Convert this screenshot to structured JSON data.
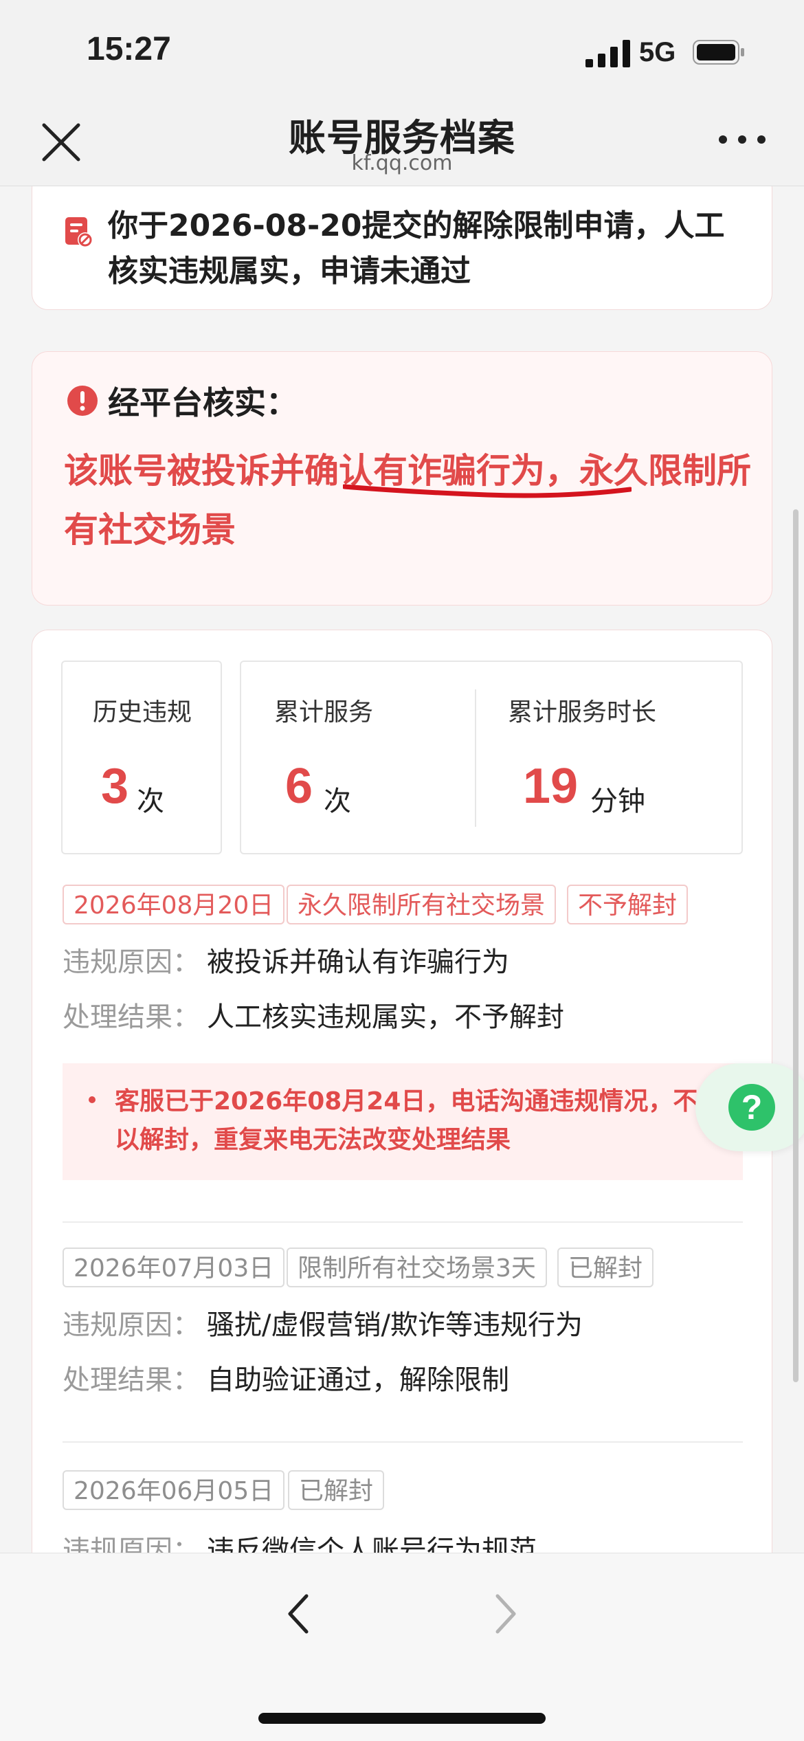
{
  "status_bar": {
    "time": "15:27",
    "network": "5G"
  },
  "nav": {
    "title": "账号服务档案",
    "domain": "kf.qq.com"
  },
  "notice": {
    "text": "你于2026-08-20提交的解除限制申请，人工核实违规属实，申请未通过"
  },
  "verification": {
    "title": "经平台核实：",
    "message": "该账号被投诉并确认有诈骗行为，永久限制所有社交场景"
  },
  "stats": [
    {
      "label": "历史违规",
      "value": "3",
      "unit": "次"
    },
    {
      "label": "累计服务",
      "value": "6",
      "unit": "次"
    },
    {
      "label": "累计服务时长",
      "value": "19",
      "unit": "分钟"
    }
  ],
  "labels": {
    "reason": "违规原因：",
    "result": "处理结果："
  },
  "records": [
    {
      "tags": [
        "2026年08月20日",
        "永久限制所有社交场景",
        "不予解封"
      ],
      "reason": "被投诉并确认有诈骗行为",
      "result": "人工核实违规属实，不予解封",
      "remark": "客服已于2026年08月24日，电话沟通违规情况，不予以解封，重复来电无法改变处理结果"
    },
    {
      "tags": [
        "2026年07月03日",
        "限制所有社交场景3天",
        "已解封"
      ],
      "reason": "骚扰/虚假营销/欺诈等违规行为",
      "result": "自助验证通过，解除限制"
    },
    {
      "tags": [
        "2026年06月05日",
        "已解封"
      ],
      "reason": "违反微信个人账号行为规范"
    }
  ],
  "help": {
    "icon": "?"
  },
  "colors": {
    "accent_red": "#e14a4a",
    "help_green": "#2ec26a"
  }
}
